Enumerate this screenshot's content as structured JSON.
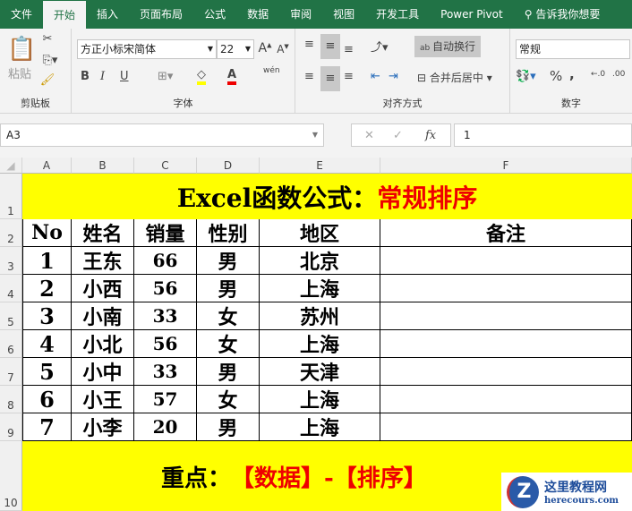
{
  "tabs": [
    "文件",
    "开始",
    "插入",
    "页面布局",
    "公式",
    "数据",
    "审阅",
    "视图",
    "开发工具",
    "Power Pivot"
  ],
  "tell_me": "告诉我你想要",
  "ribbon": {
    "clipboard": {
      "paste": "粘贴",
      "label": "剪贴板"
    },
    "font": {
      "name": "方正小标宋简体",
      "size": "22",
      "bold": "B",
      "italic": "I",
      "underline": "U",
      "label": "字体",
      "phonetic": "wén"
    },
    "alignment": {
      "wrap": "自动换行",
      "merge": "合并后居中",
      "label": "对齐方式"
    },
    "number": {
      "format": "常规",
      "percent": "%",
      "comma": ",",
      "label": "数字"
    }
  },
  "formula_bar": {
    "name_box": "A3",
    "value": "1",
    "fx": "fx"
  },
  "columns": [
    "A",
    "B",
    "C",
    "D",
    "E",
    "F"
  ],
  "rows": [
    "1",
    "2",
    "3",
    "4",
    "5",
    "6",
    "7",
    "8",
    "9",
    "10"
  ],
  "title": {
    "black": "Excel函数公式：",
    "red": "常规排序"
  },
  "headers": [
    "No",
    "姓名",
    "销量",
    "性别",
    "地区",
    "备注"
  ],
  "data": [
    [
      "1",
      "王东",
      "66",
      "男",
      "北京",
      ""
    ],
    [
      "2",
      "小西",
      "56",
      "男",
      "上海",
      ""
    ],
    [
      "3",
      "小南",
      "33",
      "女",
      "苏州",
      ""
    ],
    [
      "4",
      "小北",
      "56",
      "女",
      "上海",
      ""
    ],
    [
      "5",
      "小中",
      "33",
      "男",
      "天津",
      ""
    ],
    [
      "6",
      "小王",
      "57",
      "女",
      "上海",
      ""
    ],
    [
      "7",
      "小李",
      "20",
      "男",
      "上海",
      ""
    ]
  ],
  "footer": {
    "black": "重点：",
    "red": "【数据】-【排序】"
  },
  "watermark": {
    "title": "这里教程网",
    "url": "herecours.com"
  }
}
